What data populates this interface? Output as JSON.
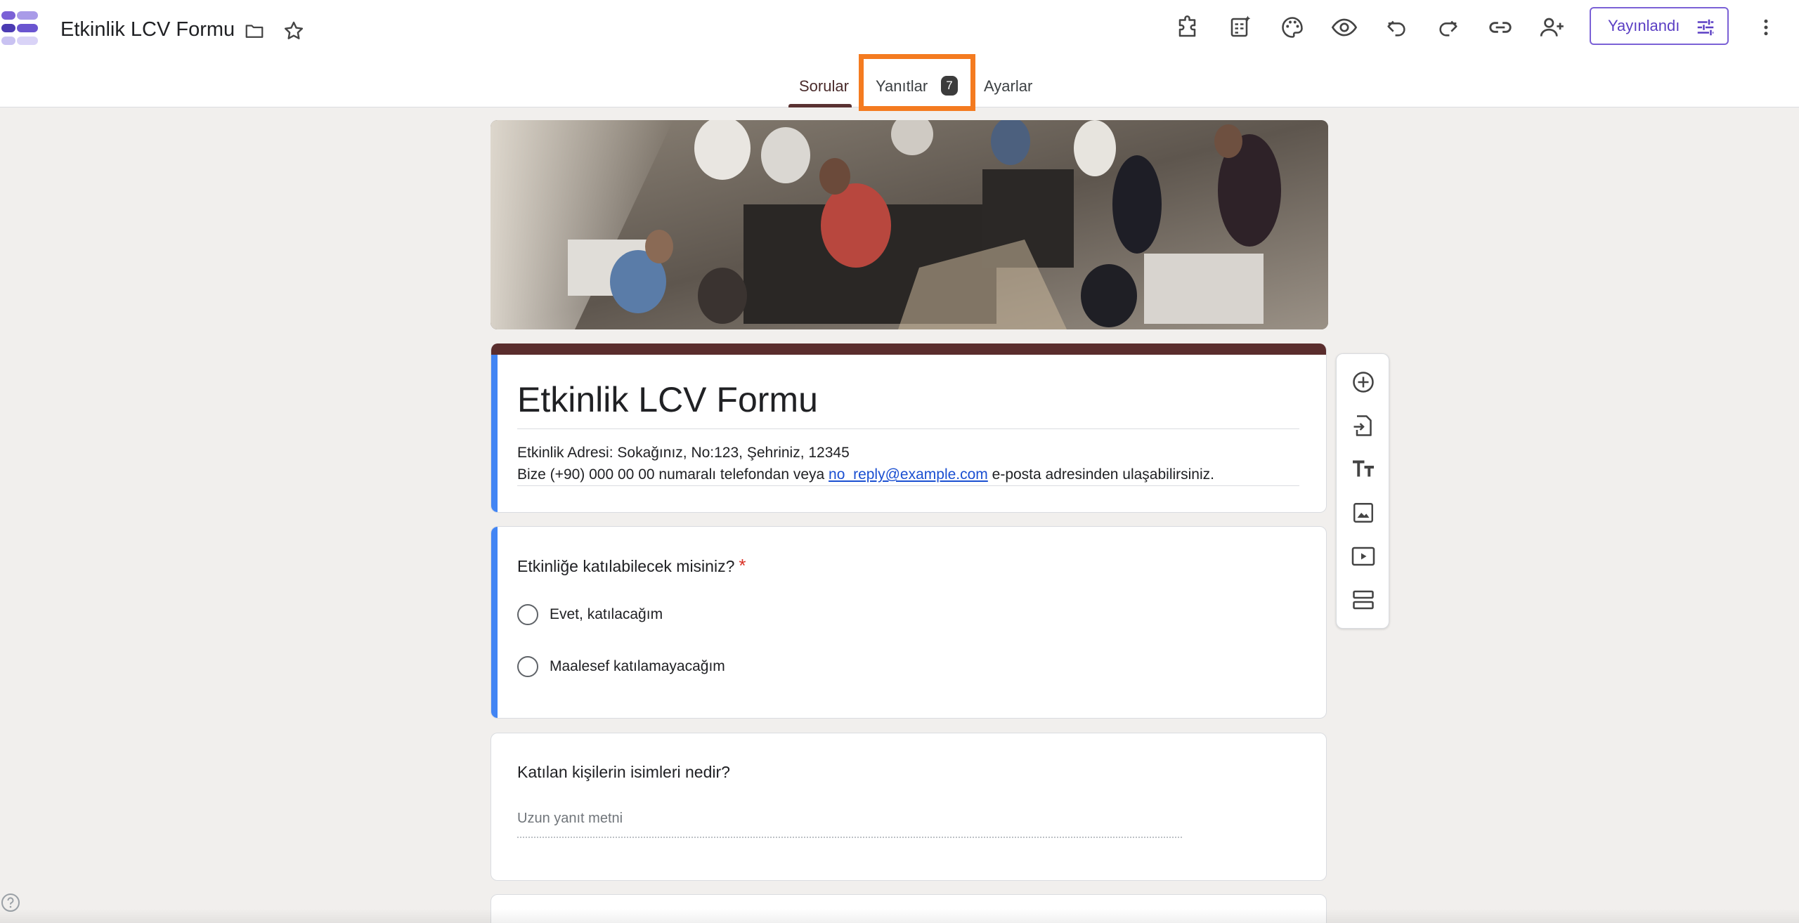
{
  "app": {
    "document_title": "Etkinlik LCV Formu",
    "publish_label": "Yayınlandı",
    "accent_color": "#7b61d6"
  },
  "icons": {
    "title": [
      "folder-icon",
      "star-icon"
    ],
    "toolbar": [
      "addons-icon",
      "ai-form-icon",
      "palette-icon",
      "preview-icon",
      "undo-icon",
      "redo-icon",
      "link-icon",
      "add-collaborator-icon"
    ],
    "more": "more-vert-icon",
    "side": [
      "add-question-icon",
      "import-questions-icon",
      "add-title-icon",
      "add-image-icon",
      "add-video-icon",
      "add-section-icon"
    ]
  },
  "tabs": [
    {
      "label": "Sorular",
      "active": true
    },
    {
      "label": "Yanıtlar",
      "badge": "7"
    },
    {
      "label": "Ayarlar"
    }
  ],
  "form": {
    "title": "Etkinlik LCV Formu",
    "description_line1": "Etkinlik Adresi: Sokağınız, No:123, Şehriniz, 12345",
    "description_line2_prefix": "Bize (+90) 000 00 00 numaralı telefondan veya ",
    "description_email": "no_reply@example.com",
    "description_line2_suffix": " e-posta adresinden ulaşabilirsiniz.",
    "header_color": "#5a2d2d"
  },
  "questions": [
    {
      "title": "Etkinliğe katılabilecek misiniz?",
      "required_mark": "*",
      "options": [
        "Evet, katılacağım",
        "Maalesef katılamayacağım"
      ]
    },
    {
      "title": "Katılan kişilerin isimleri nedir?",
      "placeholder": "Uzun yanıt metni"
    }
  ]
}
